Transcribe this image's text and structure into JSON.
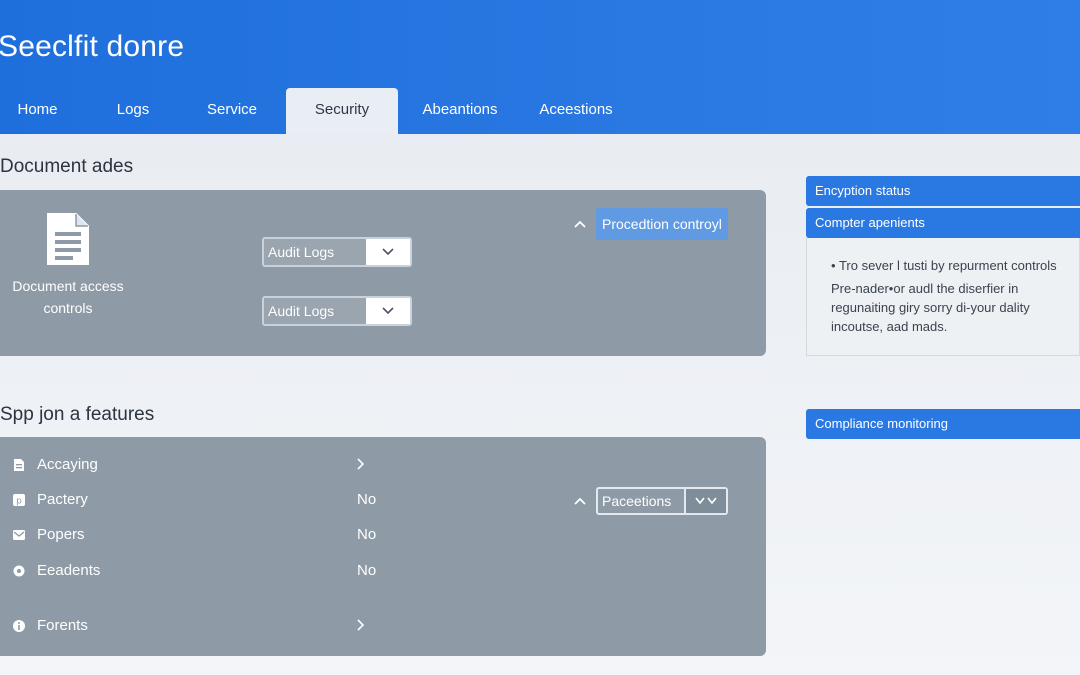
{
  "app": {
    "title": "Seeclfit donre"
  },
  "tabs": [
    {
      "label": "Home"
    },
    {
      "label": "Logs"
    },
    {
      "label": "Service"
    },
    {
      "label": "Security"
    },
    {
      "label": "Abeantions"
    },
    {
      "label": "Aceestions"
    }
  ],
  "document_section": {
    "title": "Document ades",
    "doc_label_line1": "Document access",
    "doc_label_line2": "controls",
    "selects": [
      {
        "value": "Audit Logs"
      },
      {
        "value": "Audit Logs"
      }
    ],
    "protection_button": "Procedtion controyl"
  },
  "features_section": {
    "title": "Spp jon a features",
    "items": [
      {
        "label": "Accaying",
        "value": "",
        "icon": "document-icon",
        "has_chevron": true
      },
      {
        "label": "Pactery",
        "value": "No",
        "icon": "p-square-icon",
        "has_chevron": false
      },
      {
        "label": "Popers",
        "value": "No",
        "icon": "mail-icon",
        "has_chevron": false
      },
      {
        "label": "Eeadents",
        "value": "No",
        "icon": "gear-icon",
        "has_chevron": false
      },
      {
        "label": "Forents",
        "value": "",
        "icon": "circle-info-icon",
        "has_chevron": true
      }
    ],
    "precautions_select": "Paceetions"
  },
  "right_panel": {
    "encryption_status": "Encyption status",
    "compliance_agreements": "Compter apenients",
    "bullet": "Tro sever l tusti by repurment controls",
    "paragraph_line1": "Pre-nader•or audl the diserfier in",
    "paragraph_line2": "regunaiting giry sorry di-your dality",
    "paragraph_line3": "incoutse, aad mads.",
    "compliance_monitoring": "Compliance monitoring"
  },
  "colors": {
    "header_blue": "#2a78e2",
    "panel_gray": "#8e9aa6",
    "accent_button": "#5f9ae3"
  }
}
